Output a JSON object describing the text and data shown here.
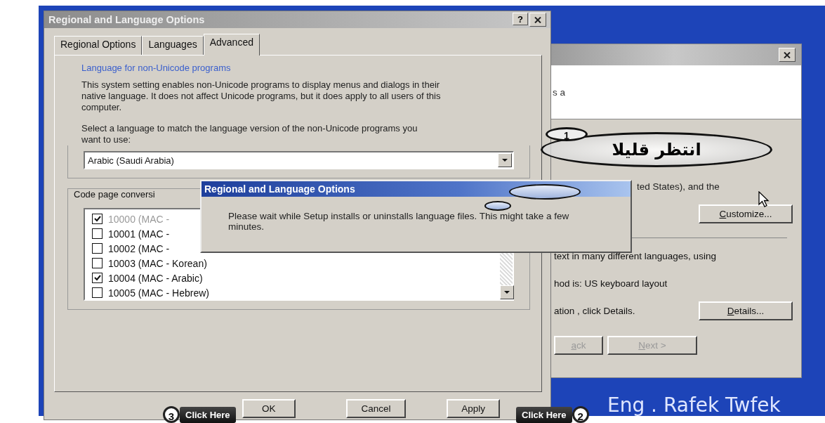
{
  "back_window": {
    "header_text": "s a",
    "locale_text": "ted States), and the",
    "customize_button": "Customize...",
    "languages_text": "text in many different languages, using",
    "input_text": "hod is: US keyboard layout",
    "details_text": "ation , click Details.",
    "details_button": "Details...",
    "nav_buttons": [
      {
        "label": "ack",
        "disabled": true
      },
      {
        "label": "Next >",
        "disabled": true
      }
    ]
  },
  "main_dialog": {
    "title": "Regional and Language Options",
    "help_button": "?",
    "tabs": [
      {
        "label": "Regional Options",
        "selected": false
      },
      {
        "label": "Languages",
        "selected": false
      },
      {
        "label": "Advanced",
        "selected": true
      }
    ],
    "section_heading": "Language for non-Unicode programs",
    "description": "This system setting enables non-Unicode programs to display menus and dialogs in their native language. It does not affect Unicode programs, but it does apply to all users of this computer.",
    "prompt": "Select a language to match the language version of the non-Unicode programs you want to use:",
    "language_dropdown": {
      "value": "Arabic (Saudi Arabia)"
    },
    "code_page_legend": "Code page conversi",
    "code_pages": [
      {
        "label": "10000 (MAC -",
        "checked": true,
        "disabled": true
      },
      {
        "label": "10001 (MAC -",
        "checked": false,
        "disabled": false
      },
      {
        "label": "10002 (MAC -",
        "checked": false,
        "disabled": false
      },
      {
        "label": "10003 (MAC - Korean)",
        "checked": false,
        "disabled": false
      },
      {
        "label": "10004 (MAC - Arabic)",
        "checked": true,
        "disabled": false
      },
      {
        "label": "10005 (MAC - Hebrew)",
        "checked": false,
        "disabled": false
      }
    ],
    "buttons": [
      "OK",
      "Cancel",
      "Apply"
    ]
  },
  "progress_dialog": {
    "title": "Regional and Language Options",
    "message": "Please wait while Setup installs or uninstalls language files. This might take a few minutes."
  },
  "annotations": {
    "balloon": {
      "step": "1",
      "text": "انتظر قليلا"
    },
    "callouts": [
      {
        "step": "3",
        "text": "Click Here"
      },
      {
        "step": "2",
        "text": "Click Here"
      }
    ],
    "credit": "Eng . Rafek Twfek"
  }
}
